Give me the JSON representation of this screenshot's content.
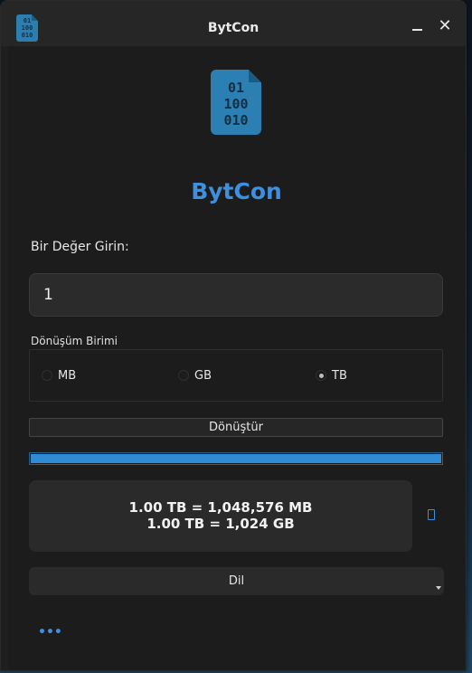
{
  "window": {
    "title": "BytCon",
    "minimize_glyph": "",
    "close_glyph": "✕"
  },
  "titlebar_icon": {
    "name": "binary-file-icon",
    "bits": "01\n100\n010"
  },
  "logo": {
    "name": "binary-file-icon",
    "bits": "01\n100\n010"
  },
  "app_name": "BytCon",
  "input": {
    "label": "Bir Değer Girin:",
    "value": "1",
    "placeholder": ""
  },
  "unit": {
    "label": "Dönüşüm Birimi",
    "options": [
      "MB",
      "GB",
      "TB"
    ],
    "selected": "TB"
  },
  "convert_button": "Dönüştür",
  "progress": {
    "percent": 100
  },
  "result": {
    "line1": "1.00 TB = 1,048,576 MB",
    "line2": "1.00 TB = 1,024 GB"
  },
  "language_select": {
    "value": "Dil"
  },
  "more_button": "•••",
  "colors": {
    "accent": "#3d8fe0",
    "progress": "#2f8bd3",
    "window_bg": "#1c1c1c"
  }
}
